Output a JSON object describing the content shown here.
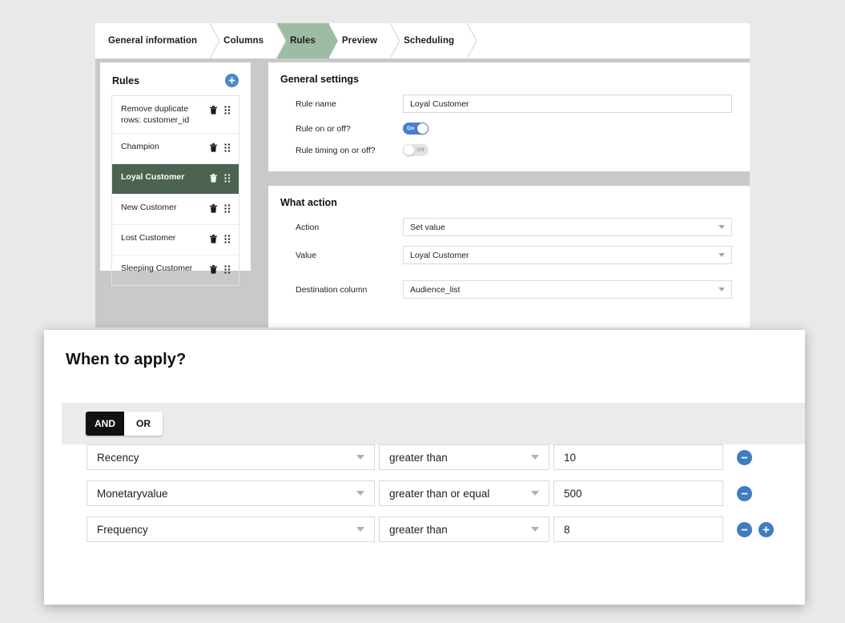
{
  "tabs": [
    {
      "label": "General information",
      "active": false
    },
    {
      "label": "Columns",
      "active": false
    },
    {
      "label": "Rules",
      "active": true
    },
    {
      "label": "Preview",
      "active": false
    },
    {
      "label": "Scheduling",
      "active": false
    }
  ],
  "rules_panel": {
    "title": "Rules",
    "add_icon": "plus-circle-icon",
    "items": [
      {
        "label": "Remove duplicate rows: customer_id",
        "selected": false
      },
      {
        "label": "Champion",
        "selected": false
      },
      {
        "label": "Loyal Customer",
        "selected": true
      },
      {
        "label": "New Customer",
        "selected": false
      },
      {
        "label": "Lost Customer",
        "selected": false
      },
      {
        "label": "Sleeping Customer",
        "selected": false
      }
    ],
    "row_icons": {
      "delete": "trash-icon",
      "drag": "grip-dots-icon"
    }
  },
  "general_settings": {
    "title": "General settings",
    "rule_name_label": "Rule name",
    "rule_name_value": "Loyal Customer",
    "rule_name_placeholder": "Rule name",
    "rule_on_label": "Rule on or off?",
    "rule_on_state": "On",
    "rule_timing_label": "Rule timing on or off?",
    "rule_timing_state": "Off"
  },
  "what_action": {
    "title": "What action",
    "action_label": "Action",
    "action_value": "Set value",
    "value_label": "Value",
    "value_value": "Loyal Customer",
    "destination_label": "Destination column",
    "destination_value": "Audience_list"
  },
  "modal": {
    "title": "When to apply?",
    "logic": {
      "and_label": "AND",
      "or_label": "OR",
      "selected": "AND"
    },
    "conditions": [
      {
        "column": "Recency",
        "operator": "greater than",
        "value": "10",
        "has_add": false
      },
      {
        "column": "Monetaryvalue",
        "operator": "greater than or equal",
        "value": "500",
        "has_add": false
      },
      {
        "column": "Frequency",
        "operator": "greater than",
        "value": "8",
        "has_add": true
      }
    ],
    "remove_icon": "minus-circle-icon",
    "add_icon": "plus-circle-icon"
  },
  "colors": {
    "page_bg": "#e9e9e9",
    "panel_backdrop": "#c9c9c9",
    "tab_active": "#9dbca4",
    "rule_selected": "#4b6350",
    "toggle_on": "#4a7fd0",
    "button_blue": "#3f7cc0",
    "band_gray": "#ebebeb"
  }
}
